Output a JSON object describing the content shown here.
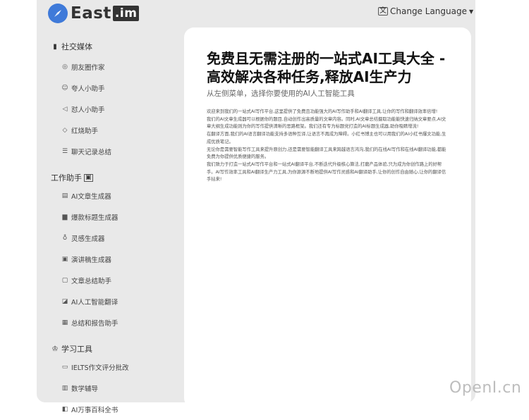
{
  "header": {
    "logo_text": "East",
    "logo_suffix": ".im",
    "language_label": "Change Language"
  },
  "sidebar": {
    "sections": [
      {
        "title": "社交媒体",
        "items": [
          "朋友圈作家",
          "夸人小助手",
          "怼人小助手",
          "红烧助手",
          "聊天记录总结"
        ]
      },
      {
        "title": "工作助手",
        "items": [
          "AI文章生成器",
          "爆款标题生成器",
          "灵感生成器",
          "演讲稿生成器",
          "文章总结助手",
          "AI人工智能翻译",
          "总结和报告助手"
        ]
      },
      {
        "title": "学习工具",
        "items": [
          "IELTS作文评分批改",
          "数学辅导",
          "AI万事百科全书"
        ]
      }
    ]
  },
  "main": {
    "headline": "免费且无需注册的一站式AI工具大全 - 高效解决各种任务,释放AI生产力",
    "subheadline": "从左侧菜单，选择你要使用的AI人工智能工具",
    "paragraphs": [
      "欢迎来到我们的一站式AI写作平台,这里提供了免费且功能强大的AI写作助手和AI翻译工具,让你的写作和翻译效率倍增!",
      "我们的AI文章生成器可以根据你的题目,自动创作出高质量的文章内容。同时,AI文章总结摄取功能能快速归纳文章要点,AI文章大纲生成功能则为你的写作提供清晰的思路框架。我们还有专为标题党打造的AI标题生成器,助你吸睛增流!",
      "在翻译方面,我们的AI语言翻译功能支持多语种互译,让语言不再成为障碍。小红书博主也可以用我们的AI小红书爆文功能,生成优质笔记。",
      "无论你是需要智能写作工具来提升原创力,还是需要智能翻译工具来跨越语言鸿沟,我们的在线AI写作和在线AI翻译功能,都能免费为你提供优质便捷的服务。",
      "我们致力于打造一站式AI写作平台和一站式AI翻译平台,不断迭代升级核心算法,打磨产品体验,只为成为你创作路上的好帮手。AI写作效率工具和AI翻译生产力工具,为你源源不断地提供AI写作灵感和AI翻译助手,让你的创作自由随心,让你的翻译信手拈来!"
    ]
  },
  "watermark": "OpenI.cn",
  "colors": {
    "accent": "#3f7ad9",
    "frame_bg": "#e9e9e9",
    "card_bg": "#ffffff"
  }
}
